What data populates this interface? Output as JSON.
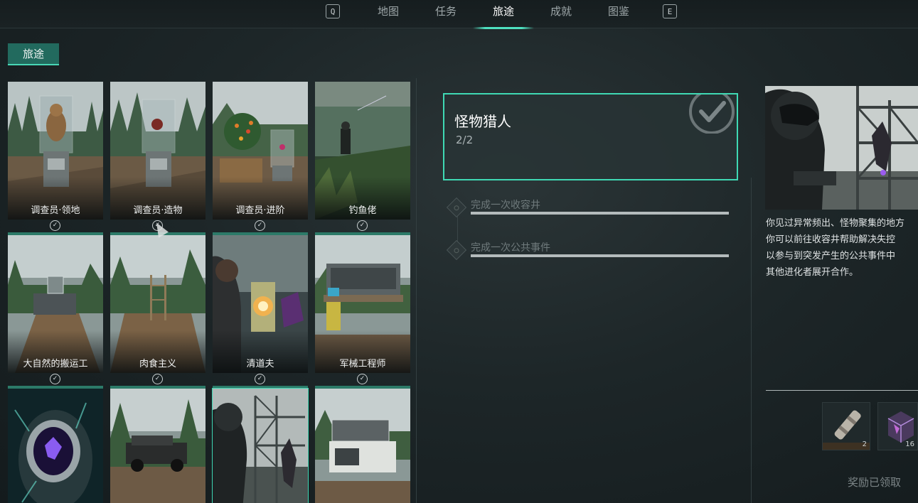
{
  "nav": {
    "left_key": "Q",
    "right_key": "E",
    "tabs": [
      {
        "label": "地图",
        "active": false
      },
      {
        "label": "任务",
        "active": false
      },
      {
        "label": "旅途",
        "active": true
      },
      {
        "label": "成就",
        "active": false
      },
      {
        "label": "图鉴",
        "active": false
      }
    ]
  },
  "section_tab": "旅途",
  "cards": [
    {
      "label": "调查员·领地",
      "completed": true
    },
    {
      "label": "调查员·造物",
      "completed": true
    },
    {
      "label": "调查员·进阶",
      "completed": true
    },
    {
      "label": "钓鱼佬",
      "completed": true
    },
    {
      "label": "大自然的搬运工",
      "completed": true
    },
    {
      "label": "肉食主义",
      "completed": true
    },
    {
      "label": "清道夫",
      "completed": true
    },
    {
      "label": "军械工程师",
      "completed": true
    },
    {
      "label": "",
      "completed": false
    },
    {
      "label": "",
      "completed": false
    },
    {
      "label": "",
      "completed": false,
      "selected": true
    },
    {
      "label": "",
      "completed": false
    }
  ],
  "achievement": {
    "title": "怪物猎人",
    "progress": "2/2",
    "tasks": [
      {
        "label": "完成一次收容井",
        "progress": 1.0
      },
      {
        "label": "完成一次公共事件",
        "progress": 1.0
      }
    ]
  },
  "details": {
    "description_lines": [
      "你见过异常频出、怪物聚集的地方",
      "你可以前往收容井帮助解决失控",
      "以参与到突发产生的公共事件中",
      "其他进化者展开合作。"
    ],
    "rewards": [
      {
        "item": "canister",
        "quantity": "2"
      },
      {
        "item": "crystal-cube",
        "quantity": "16"
      }
    ],
    "claimed_label": "奖励已领取"
  },
  "colors": {
    "accent": "#3fd9b4",
    "tab_active_bg": "#226a5e",
    "progress_bar": "#2c7a68"
  }
}
